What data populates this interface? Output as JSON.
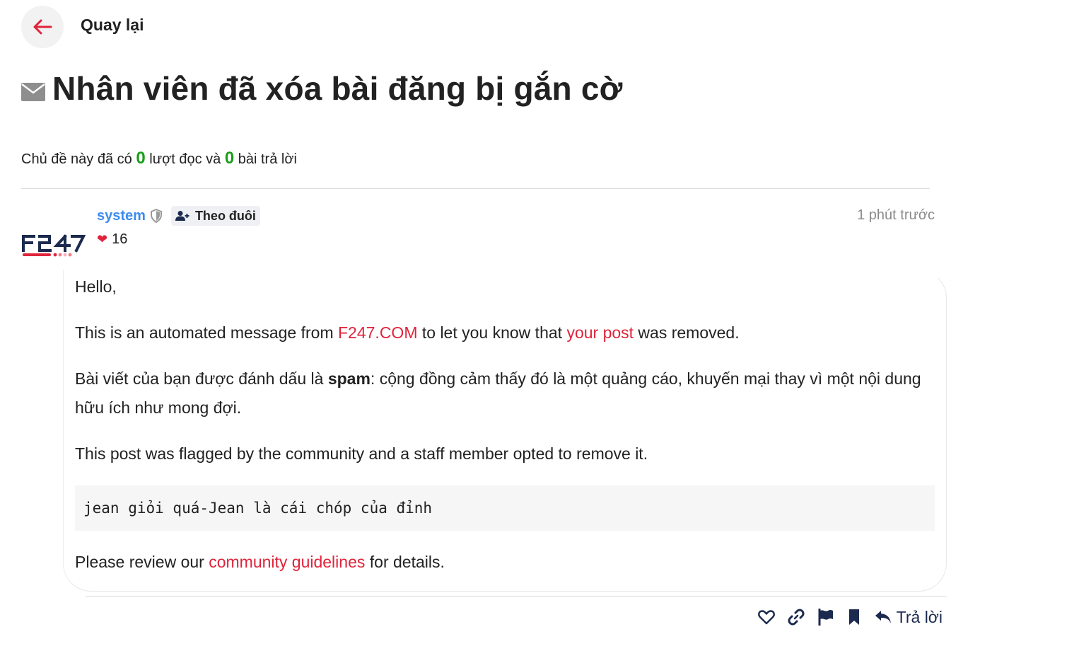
{
  "nav": {
    "back_label": "Quay lại"
  },
  "topic": {
    "title": "Nhân viên đã xóa bài đăng bị gắn cờ",
    "stats_prefix": "Chủ đề này đã có",
    "views": "0",
    "stats_middle": "lượt đọc và",
    "replies": "0",
    "stats_suffix": "bài trả lời"
  },
  "post": {
    "author": "system",
    "follow_label": "Theo đuôi",
    "likes": "16",
    "time": "1 phút trước",
    "greeting": "Hello,",
    "p1_a": "This is an automated message from ",
    "p1_link1": "F247.COM",
    "p1_b": " to let you know that ",
    "p1_link2": "your post",
    "p1_c": " was removed.",
    "p2_a": "Bài viết của bạn được đánh dấu là ",
    "p2_bold": "spam",
    "p2_b": ": cộng đồng cảm thấy đó là một quảng cáo, khuyến mại thay vì một nội dung hữu ích như mong đợi.",
    "p3": "This post was flagged by the community and a staff member opted to remove it.",
    "code": "jean giỏi quá-Jean là cái chóp của đỉnh",
    "p4_a": "Please review our ",
    "p4_link": "community guidelines",
    "p4_b": " for details."
  },
  "actions": {
    "reply_label": "Trả lời"
  },
  "colors": {
    "accent_red": "#e0243b",
    "author_blue": "#3d8bef",
    "stat_green": "#1a9e1a",
    "icon_navy": "#1b2a4e"
  },
  "icons": [
    "arrow-left-icon",
    "envelope-icon",
    "shield-icon",
    "user-plus-icon",
    "heart-icon",
    "link-icon",
    "flag-icon",
    "bookmark-icon",
    "reply-icon"
  ]
}
